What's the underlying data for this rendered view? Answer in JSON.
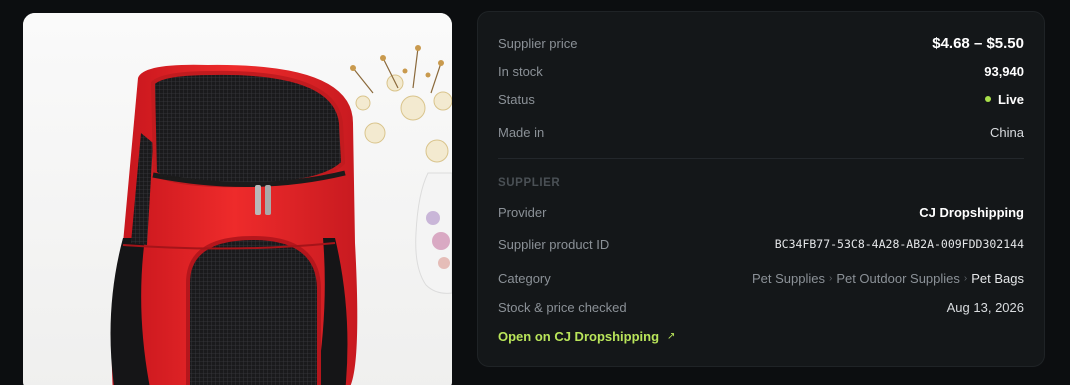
{
  "product": {
    "image_alt": "Red and black mesh pet carrier backpack"
  },
  "details": {
    "supplier_price": {
      "label": "Supplier price",
      "value": "$4.68 – $5.50"
    },
    "in_stock": {
      "label": "In stock",
      "value": "93,940"
    },
    "status": {
      "label": "Status",
      "value": "Live",
      "color": "#a8e04a"
    },
    "made_in": {
      "label": "Made in",
      "value": "China"
    }
  },
  "supplier": {
    "section_title": "SUPPLIER",
    "provider": {
      "label": "Provider",
      "value": "CJ Dropshipping"
    },
    "product_id": {
      "label": "Supplier product ID",
      "value": "BC34FB77-53C8-4A28-AB2A-009FDD302144"
    },
    "category": {
      "label": "Category",
      "crumbs": [
        "Pet Supplies",
        "Pet Outdoor Supplies",
        "Pet Bags"
      ]
    },
    "checked": {
      "label": "Stock & price checked",
      "value": "Aug 13, 2026"
    },
    "open_link": {
      "label": "Open on CJ Dropshipping",
      "icon": "external-arrow-icon"
    }
  },
  "colors": {
    "accent": "#b9e55a",
    "panel": "#141719",
    "background": "#0c0e10"
  }
}
